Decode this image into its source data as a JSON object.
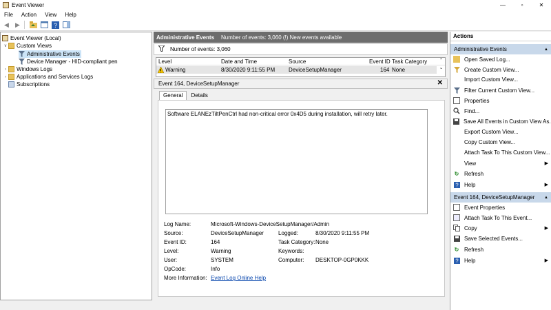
{
  "window": {
    "title": "Event Viewer",
    "controls": [
      "—",
      "▫",
      "✕"
    ]
  },
  "menu": [
    "File",
    "Action",
    "View",
    "Help"
  ],
  "tree": {
    "root": "Event Viewer (Local)",
    "custom_views": "Custom Views",
    "admin_events": "Administrative Events",
    "device_manager": "Device Manager - HID-compliant pen",
    "windows_logs": "Windows Logs",
    "app_services": "Applications and Services Logs",
    "subscriptions": "Subscriptions"
  },
  "center": {
    "header_title": "Administrative Events",
    "header_info": "Number of events: 3,060 (!) New events available",
    "count_label": "Number of events: 3,060",
    "columns": [
      "Level",
      "Date and Time",
      "Source",
      "Event ID",
      "Task Category"
    ],
    "row": {
      "level": "Warning",
      "date": "8/30/2020 9:11:55 PM",
      "source": "DeviceSetupManager",
      "event_id": "164",
      "task": "None"
    },
    "detail_title": "Event 164, DeviceSetupManager",
    "tabs": [
      "General",
      "Details"
    ],
    "message": "Software ELANEzTiltPenCtrl had non-critical error 0x4D5 during installation, will retry later.",
    "props": {
      "log_name_label": "Log Name:",
      "log_name": "Microsoft-Windows-DeviceSetupManager/Admin",
      "source_label": "Source:",
      "source": "DeviceSetupManager",
      "logged_label": "Logged:",
      "logged": "8/30/2020 9:11:55 PM",
      "event_id_label": "Event ID:",
      "event_id": "164",
      "task_cat_label": "Task Category:",
      "task_cat": "None",
      "level_label": "Level:",
      "level": "Warning",
      "keywords_label": "Keywords:",
      "user_label": "User:",
      "user": "SYSTEM",
      "computer_label": "Computer:",
      "computer": "DESKTOP-0GP0KKK",
      "opcode_label": "OpCode:",
      "opcode": "Info",
      "more_info_label": "More Information:",
      "more_info_link": "Event Log Online Help"
    }
  },
  "actions": {
    "title": "Actions",
    "section1": "Administrative Events",
    "items1": [
      "Open Saved Log...",
      "Create Custom View...",
      "Import Custom View...",
      "Filter Current Custom View...",
      "Properties",
      "Find...",
      "Save All Events in Custom View As...",
      "Export Custom View...",
      "Copy Custom View...",
      "Attach Task To This Custom View...",
      "View",
      "Refresh",
      "Help"
    ],
    "section2": "Event 164, DeviceSetupManager",
    "items2": [
      "Event Properties",
      "Attach Task To This Event...",
      "Copy",
      "Save Selected Events...",
      "Refresh",
      "Help"
    ]
  }
}
